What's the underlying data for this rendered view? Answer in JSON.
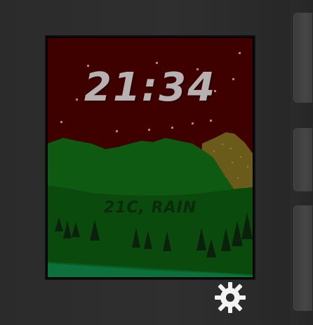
{
  "watch": {
    "time": "21:34",
    "weather": "21C, RAIN"
  },
  "icons": {
    "settings": "gear-icon"
  },
  "colors": {
    "bezel": "#2a2a2a",
    "sky": "#3f0000",
    "stars": "#b38a4a",
    "hills_dark": "#0f5a12",
    "hills_front": "#0a4a0d",
    "trees": "#0b210b",
    "ground": "#0b6b3a",
    "time_text": "#b7b1b1",
    "weather_text": "#0a2a0a"
  }
}
